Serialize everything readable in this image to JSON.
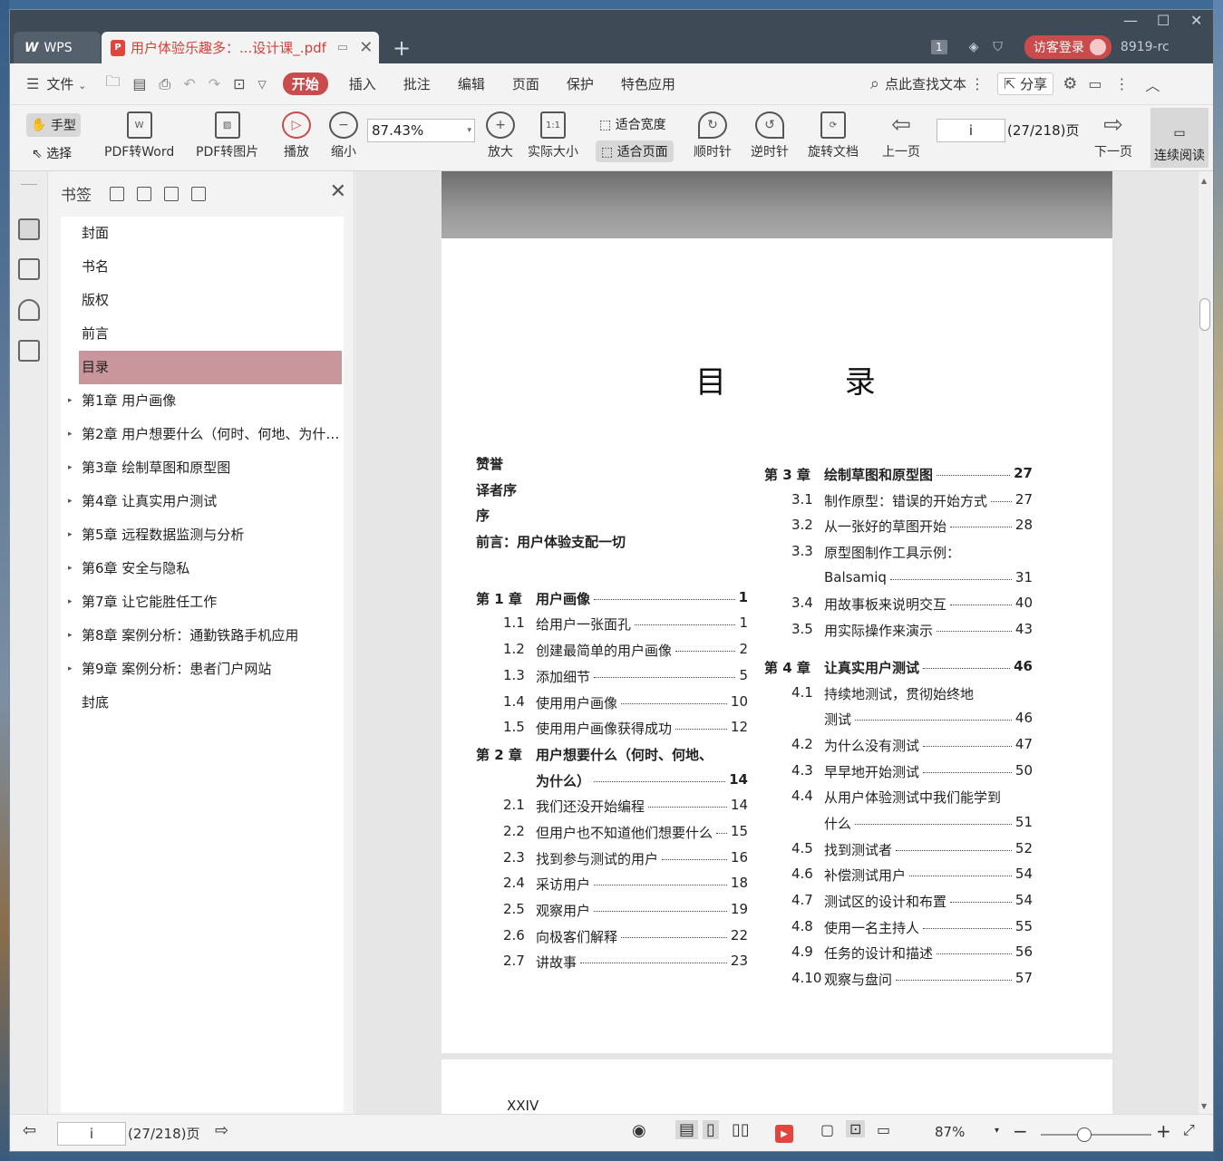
{
  "titlebar": {
    "app_tab": "WPS",
    "doc_tab": "用户体验乐趣多：...设计课_.pdf",
    "new_tab": "+",
    "counter_badge": "1",
    "login": "访客登录",
    "version": "8919-rc"
  },
  "menubar": {
    "file": "文件",
    "items": [
      "开始",
      "插入",
      "批注",
      "编辑",
      "页面",
      "保护",
      "特色应用"
    ],
    "search": "点此查找文本",
    "share": "分享"
  },
  "toolbar": {
    "hand": "手型",
    "select": "选择",
    "pdf_to_word": "PDF转Word",
    "pdf_to_image": "PDF转图片",
    "play": "播放",
    "zoom_out": "缩小",
    "zoom_value": "87.43%",
    "zoom_in": "放大",
    "actual_size": "实际大小",
    "fit_width": "适合宽度",
    "fit_page": "适合页面",
    "clockwise": "顺时针",
    "counter_clockwise": "逆时针",
    "rotate_doc": "旋转文档",
    "prev_page": "上一页",
    "page_value": "i",
    "page_count": "(27/218)页",
    "next_page": "下一页",
    "continuous": "连续阅读"
  },
  "bookmarks": {
    "title": "书签",
    "items": [
      {
        "label": "封面",
        "expandable": false
      },
      {
        "label": "书名",
        "expandable": false
      },
      {
        "label": "版权",
        "expandable": false
      },
      {
        "label": "前言",
        "expandable": false
      },
      {
        "label": "目录",
        "expandable": false,
        "selected": true
      },
      {
        "label": "第1章  用户画像",
        "expandable": true
      },
      {
        "label": "第2章  用户想要什么（何时、何地、为什…",
        "expandable": true
      },
      {
        "label": "第3章  绘制草图和原型图",
        "expandable": true
      },
      {
        "label": "第4章  让真实用户测试",
        "expandable": true
      },
      {
        "label": "第5章  远程数据监测与分析",
        "expandable": true
      },
      {
        "label": "第6章  安全与隐私",
        "expandable": true
      },
      {
        "label": "第7章  让它能胜任工作",
        "expandable": true
      },
      {
        "label": "第8章  案例分析：通勤铁路手机应用",
        "expandable": true
      },
      {
        "label": "第9章  案例分析：患者门户网站",
        "expandable": true
      },
      {
        "label": "封底",
        "expandable": false
      }
    ]
  },
  "page": {
    "title": "目 录",
    "left": [
      {
        "num": "赞誉",
        "title": "",
        "page": "",
        "type": "front"
      },
      {
        "num": "译者序",
        "title": "",
        "page": "",
        "type": "front"
      },
      {
        "num": "序",
        "title": "",
        "page": "",
        "type": "front"
      },
      {
        "num": "前言：用户体验支配一切",
        "title": "",
        "page": "",
        "type": "front"
      },
      {
        "num": "",
        "title": "",
        "page": "",
        "type": "gap"
      },
      {
        "num": "第 1 章",
        "title": "用户画像",
        "page": "1",
        "type": "ch"
      },
      {
        "num": "1.1",
        "title": "给用户一张面孔",
        "page": "1",
        "type": "sec"
      },
      {
        "num": "1.2",
        "title": "创建最简单的用户画像",
        "page": "2",
        "type": "sec"
      },
      {
        "num": "1.3",
        "title": "添加细节",
        "page": "5",
        "type": "sec"
      },
      {
        "num": "1.4",
        "title": "使用用户画像",
        "page": "10",
        "type": "sec"
      },
      {
        "num": "1.5",
        "title": "使用用户画像获得成功",
        "page": "12",
        "type": "sec"
      },
      {
        "num": "第 2 章",
        "title": "用户想要什么（何时、何地、",
        "page": "",
        "type": "ch-nolead"
      },
      {
        "num": "",
        "title": "为什么）",
        "page": "14",
        "type": "ch"
      },
      {
        "num": "2.1",
        "title": "我们还没开始编程",
        "page": "14",
        "type": "sec"
      },
      {
        "num": "2.2",
        "title": "但用户也不知道他们想要什么",
        "page": "15",
        "type": "sec"
      },
      {
        "num": "2.3",
        "title": "找到参与测试的用户",
        "page": "16",
        "type": "sec"
      },
      {
        "num": "2.4",
        "title": "采访用户",
        "page": "18",
        "type": "sec"
      },
      {
        "num": "2.5",
        "title": "观察用户",
        "page": "19",
        "type": "sec"
      },
      {
        "num": "2.6",
        "title": "向极客们解释",
        "page": "22",
        "type": "sec"
      },
      {
        "num": "2.7",
        "title": "讲故事",
        "page": "23",
        "type": "sec"
      }
    ],
    "right": [
      {
        "num": "第 3 章",
        "title": "绘制草图和原型图",
        "page": "27",
        "type": "ch"
      },
      {
        "num": "3.1",
        "title": "制作原型：错误的开始方式",
        "page": "27",
        "type": "sec"
      },
      {
        "num": "3.2",
        "title": "从一张好的草图开始",
        "page": "28",
        "type": "sec"
      },
      {
        "num": "3.3",
        "title": "原型图制作工具示例：",
        "page": "",
        "type": "sec-nolead"
      },
      {
        "num": "",
        "title": "Balsamiq",
        "page": "31",
        "type": "sec"
      },
      {
        "num": "3.4",
        "title": "用故事板来说明交互",
        "page": "40",
        "type": "sec"
      },
      {
        "num": "3.5",
        "title": "用实际操作来演示",
        "page": "43",
        "type": "sec"
      },
      {
        "num": "第 4 章",
        "title": "让真实用户测试",
        "page": "46",
        "type": "ch"
      },
      {
        "num": "4.1",
        "title": "持续地测试，贯彻始终地",
        "page": "",
        "type": "sec-nolead"
      },
      {
        "num": "",
        "title": "测试",
        "page": "46",
        "type": "sec"
      },
      {
        "num": "4.2",
        "title": "为什么没有测试",
        "page": "47",
        "type": "sec"
      },
      {
        "num": "4.3",
        "title": "早早地开始测试",
        "page": "50",
        "type": "sec"
      },
      {
        "num": "4.4",
        "title": "从用户体验测试中我们能学到",
        "page": "",
        "type": "sec-nolead"
      },
      {
        "num": "",
        "title": "什么",
        "page": "51",
        "type": "sec"
      },
      {
        "num": "4.5",
        "title": "找到测试者",
        "page": "52",
        "type": "sec"
      },
      {
        "num": "4.6",
        "title": "补偿测试用户",
        "page": "54",
        "type": "sec"
      },
      {
        "num": "4.7",
        "title": "测试区的设计和布置",
        "page": "54",
        "type": "sec"
      },
      {
        "num": "4.8",
        "title": "使用一名主持人",
        "page": "55",
        "type": "sec"
      },
      {
        "num": "4.9",
        "title": "任务的设计和描述",
        "page": "56",
        "type": "sec"
      },
      {
        "num": "4.10",
        "title": "观察与盘问",
        "page": "57",
        "type": "sec"
      }
    ],
    "next_page_number": "XXIV"
  },
  "statusbar": {
    "page_value": "i",
    "page_count": "(27/218)页",
    "zoom": "87%"
  },
  "colors": {
    "accent": "#c94b4b",
    "bookmark_selected": "#c9969b",
    "titlebar": "#3f4a57"
  }
}
